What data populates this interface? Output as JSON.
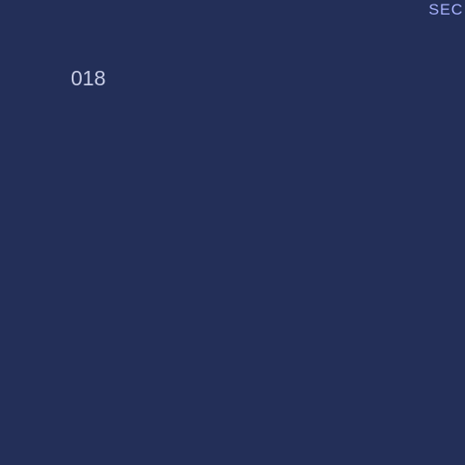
{
  "screen": {
    "background_color": "#232f58",
    "corner_label": "SEC",
    "corner_label_color": "#a9b3ff",
    "value": "018",
    "value_color": "#c7cce5"
  }
}
